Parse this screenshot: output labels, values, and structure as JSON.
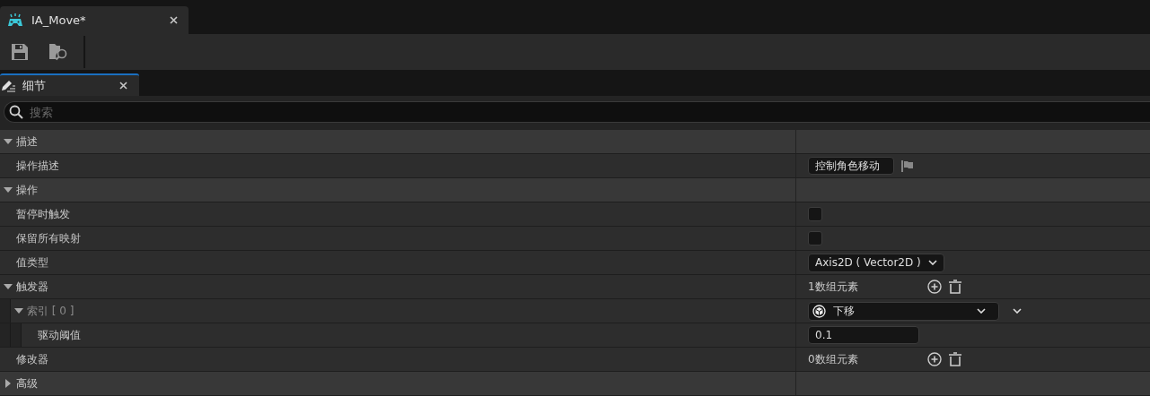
{
  "document_tab": {
    "title": "IA_Move*"
  },
  "panel_tab": {
    "title": "细节"
  },
  "search": {
    "placeholder": "搜索"
  },
  "details": [
    {
      "kind": "category",
      "label": "描述",
      "expanded": true,
      "children": [
        {
          "kind": "property",
          "label": "操作描述",
          "value": {
            "kind": "text",
            "text": "控制角色移动"
          }
        }
      ]
    },
    {
      "kind": "category",
      "label": "操作",
      "expanded": true,
      "children": [
        {
          "kind": "property",
          "label": "暂停时触发",
          "value": {
            "kind": "checkbox",
            "checked": false
          }
        },
        {
          "kind": "property",
          "label": "保留所有映射",
          "value": {
            "kind": "checkbox",
            "checked": false
          }
        },
        {
          "kind": "property",
          "label": "值类型",
          "value": {
            "kind": "combo",
            "text": "Axis2D ( Vector2D )"
          }
        },
        {
          "kind": "property",
          "label": "触发器",
          "expanded": true,
          "value": {
            "kind": "array",
            "text": "1数组元素"
          },
          "children": [
            {
              "kind": "property",
              "label": "索引 [ 0 ]",
              "expanded": true,
              "value": {
                "kind": "enum",
                "text": "下移"
              },
              "children": [
                {
                  "kind": "property",
                  "label": "驱动阈值",
                  "value": {
                    "kind": "number",
                    "text": "0.1"
                  }
                }
              ]
            }
          ]
        },
        {
          "kind": "property",
          "label": "修改器",
          "value": {
            "kind": "array",
            "text": "0数组元素"
          }
        }
      ]
    },
    {
      "kind": "category",
      "label": "高级",
      "expanded": false
    }
  ]
}
